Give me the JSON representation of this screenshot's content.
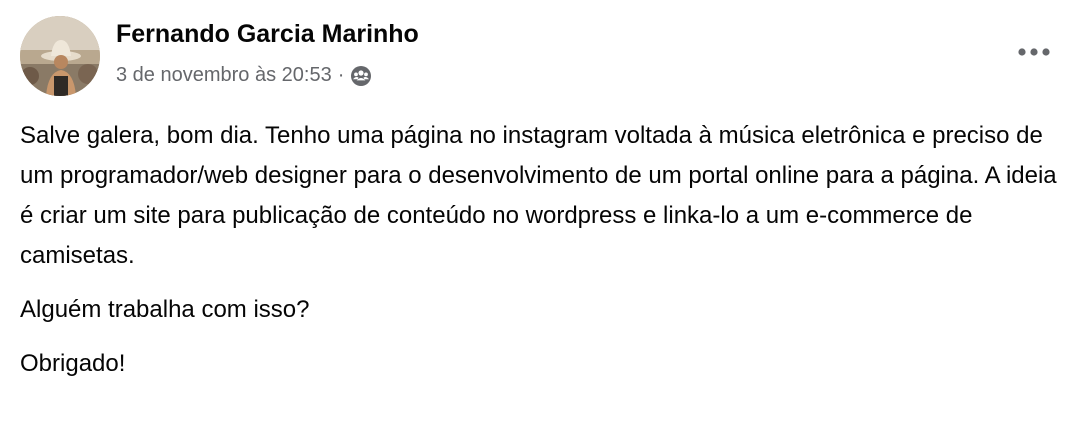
{
  "author": {
    "name": "Fernando Garcia Marinho"
  },
  "meta": {
    "timestamp": "3 de novembro às 20:53",
    "separator": "·",
    "audience_icon": "group-icon"
  },
  "actions": {
    "more_icon": "more-options-icon"
  },
  "post": {
    "paragraphs": [
      "Salve galera, bom dia. Tenho uma página no instagram voltada à música eletrônica e preciso de um programador/web designer para o desenvolvimento de um portal online para a página. A ideia é criar um site para publicação de conteúdo no wordpress e linka-lo a um e-commerce de camisetas.",
      "Alguém trabalha com isso?",
      "Obrigado!"
    ]
  },
  "colors": {
    "text_primary": "#050505",
    "text_secondary": "#65676b",
    "background": "#ffffff"
  }
}
